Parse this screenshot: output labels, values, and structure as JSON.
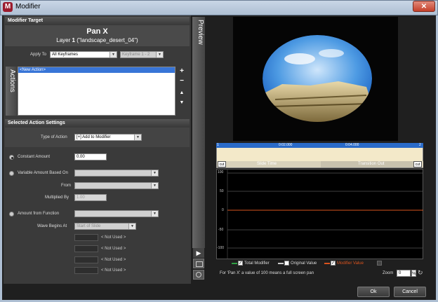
{
  "window": {
    "title": "Modifier",
    "app_icon": "M"
  },
  "modifier_target": {
    "header": "Modifier Target",
    "name": "Pan X",
    "layer_prefix": "Layer",
    "layer_number": "1",
    "layer_name": "(\"landscape_desert_04\")",
    "apply_to_label": "Apply To",
    "apply_to_value": "All Keyframes",
    "keyframe_value": "Keyframe 1 - 2"
  },
  "actions": {
    "tab_label": "Actions",
    "items": [
      "<New Action>"
    ],
    "add_symbol": "+",
    "remove_symbol": "−",
    "up_symbol": "▲",
    "down_symbol": "▼"
  },
  "settings": {
    "header": "Selected Action Settings",
    "type_label": "Type of Action",
    "type_value": "[+] Add to Modifier",
    "constant_label": "Constant Amount",
    "constant_value": "0.00",
    "variable_label": "Variable Amount Based On",
    "variable_value": "",
    "from_label": "From",
    "from_value": "",
    "multiplied_label": "Multiplied By",
    "multiplied_value": "1.00",
    "function_label": "Amount from Function",
    "function_value": "",
    "wave_label": "Wave Begins At",
    "wave_value": "Start of Slide",
    "not_used": [
      "< Not Used >",
      "< Not Used >",
      "< Not Used >",
      "< Not Used >"
    ]
  },
  "preview": {
    "tab_label": "Preview",
    "timeline": {
      "start_marker": "1",
      "end_marker": "2",
      "time_1": "0:02.000",
      "time_2": "0:04.000",
      "cut_left": "cut",
      "cut_right": "cut",
      "slide_time": "Slide Time",
      "transition_out": "Transition Out"
    },
    "graph": {
      "y_ticks": [
        "100",
        "50",
        "0",
        "-50",
        "-100"
      ]
    },
    "legend": {
      "total": "Total Modifier",
      "original": "Original Value",
      "modifier": "Modifier Value"
    },
    "legend_colors": {
      "total": "#2ea043",
      "original": "#cccccc",
      "modifier": "#d9531e"
    },
    "info_text": "For 'Pan X' a value of 100 means a full screen pan",
    "zoom_label": "Zoom",
    "zoom_value": "0",
    "zoom_unit": "%"
  },
  "footer": {
    "ok": "Ok",
    "cancel": "Cancel"
  }
}
